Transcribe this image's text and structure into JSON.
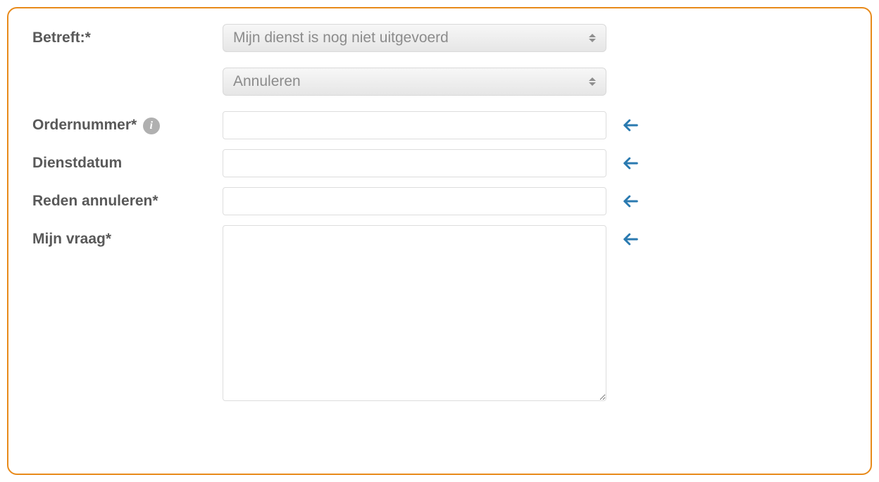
{
  "form": {
    "betreft": {
      "label": "Betreft:*",
      "selected": "Mijn dienst is nog niet uitgevoerd"
    },
    "sub_select": {
      "selected": "Annuleren"
    },
    "ordernummer": {
      "label": "Ordernummer*",
      "value": ""
    },
    "dienstdatum": {
      "label": "Dienstdatum",
      "value": ""
    },
    "reden_annuleren": {
      "label": "Reden annuleren*",
      "value": ""
    },
    "mijn_vraag": {
      "label": "Mijn vraag*",
      "value": ""
    }
  }
}
